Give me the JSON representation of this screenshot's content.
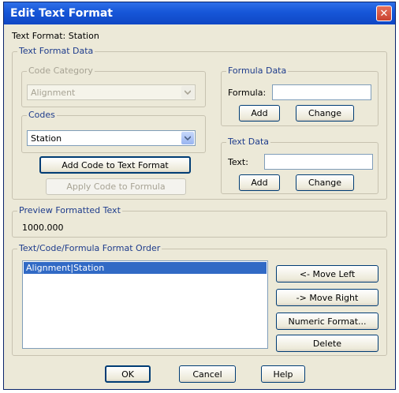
{
  "window": {
    "title": "Edit Text Format",
    "close_symbol": "✕",
    "subtitle": "Text Format: Station"
  },
  "text_format_data": {
    "legend": "Text Format Data",
    "code_category": {
      "legend": "Code Category",
      "value": "Alignment"
    },
    "codes": {
      "legend": "Codes",
      "value": "Station"
    },
    "add_code_button": "Add Code to Text Format",
    "apply_code_button": "Apply Code to Formula",
    "formula_data": {
      "legend": "Formula Data",
      "formula_label": "Formula:",
      "formula_value": "",
      "add_button": "Add",
      "change_button": "Change"
    },
    "text_data": {
      "legend": "Text Data",
      "text_label": "Text:",
      "text_value": "",
      "add_button": "Add",
      "change_button": "Change"
    }
  },
  "preview": {
    "legend": "Preview Formatted Text",
    "value": "1000.000"
  },
  "order": {
    "legend": "Text/Code/Formula Format Order",
    "items": [
      "Alignment|Station"
    ],
    "move_left_button": "<- Move Left",
    "move_right_button": "-> Move Right",
    "numeric_format_button": "Numeric Format...",
    "delete_button": "Delete"
  },
  "footer": {
    "ok_button": "OK",
    "cancel_button": "Cancel",
    "help_button": "Help"
  },
  "colors": {
    "title_bar": "#1656d8",
    "dialog_bg": "#ece9d8",
    "selection": "#316ac5",
    "legend_text": "#1e3c8c"
  }
}
